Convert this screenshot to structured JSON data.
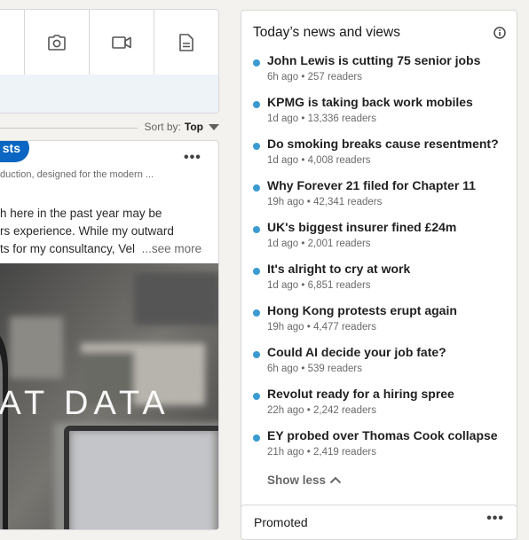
{
  "sort": {
    "label": "Sort by:",
    "value": "Top"
  },
  "post": {
    "tag": "sts",
    "subtitle": "duction, designed for the modern ...",
    "body_lines": [
      "h here in the past year may be",
      "rs experience. While my outward",
      "ts for my consultancy, Vel"
    ],
    "see_more": "...see more",
    "overlay_text": "HAT DATA"
  },
  "news": {
    "title": "Today’s news and views",
    "items": [
      {
        "headline": "John Lewis is cutting 75 senior jobs",
        "meta": "6h ago • 257 readers"
      },
      {
        "headline": "KPMG is taking back work mobiles",
        "meta": "1d ago • 13,336 readers"
      },
      {
        "headline": "Do smoking breaks cause resentment?",
        "meta": "1d ago • 4,008 readers"
      },
      {
        "headline": "Why Forever 21 filed for Chapter 11",
        "meta": "19h ago • 42,341 readers"
      },
      {
        "headline": "UK's biggest insurer fined £24m",
        "meta": "1d ago • 2,001 readers"
      },
      {
        "headline": "It's alright to cry at work",
        "meta": "1d ago • 6,851 readers"
      },
      {
        "headline": "Hong Kong protests erupt again",
        "meta": "19h ago • 4,477 readers"
      },
      {
        "headline": "Could AI decide your job fate?",
        "meta": "6h ago • 539 readers"
      },
      {
        "headline": "Revolut ready for a hiring spree",
        "meta": "22h ago • 2,242 readers"
      },
      {
        "headline": "EY probed over Thomas Cook collapse",
        "meta": "21h ago • 2,419 readers"
      }
    ],
    "show_less": "Show less"
  },
  "promoted": {
    "title": "Promoted"
  },
  "colors": {
    "accent": "#0a66c2",
    "news_dot": "#3b9bd1"
  }
}
